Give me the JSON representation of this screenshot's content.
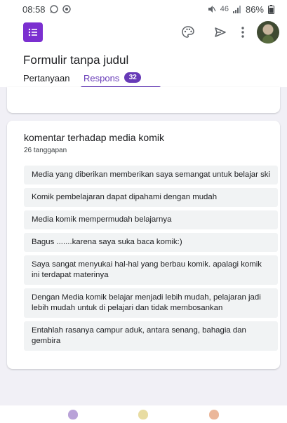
{
  "status_bar": {
    "time": "08:58",
    "left_icons": [
      "whatsapp-icon",
      "notification-icon"
    ],
    "signal_text": "46",
    "battery": "86%"
  },
  "header": {
    "form_title": "Formulir tanpa judul",
    "icons": [
      "palette-icon",
      "send-icon",
      "more-vert-icon"
    ],
    "tabs": [
      {
        "label": "Pertanyaan"
      },
      {
        "label": "Respons",
        "badge": "32"
      }
    ]
  },
  "colors": {
    "accent": "#673ab7",
    "logo": "#7b2fd0",
    "background": "#f1f0f6"
  },
  "card": {
    "question": "komentar terhadap media komik",
    "count": "26 tanggapan",
    "responses": [
      "Media yang diberikan memberikan saya semangat untuk belajar ski",
      "Komik pembelajaran dapat dipahami dengan mudah",
      "Media komik mempermudah belajarnya",
      "Bagus .......karena saya suka baca komik:)",
      "Saya sangat menyukai hal-hal yang berbau komik. apalagi komik ini terdapat materinya",
      "Dengan Media komik belajar menjadi lebih mudah, pelajaran jadi lebih mudah untuk di pelajari dan tidak membosankan",
      "Entahlah rasanya campur aduk, antara senang, bahagia dan gembira"
    ]
  },
  "bottom_nav": [
    "emoji-purple-icon",
    "emoji-yellow-icon",
    "emoji-orange-icon"
  ]
}
